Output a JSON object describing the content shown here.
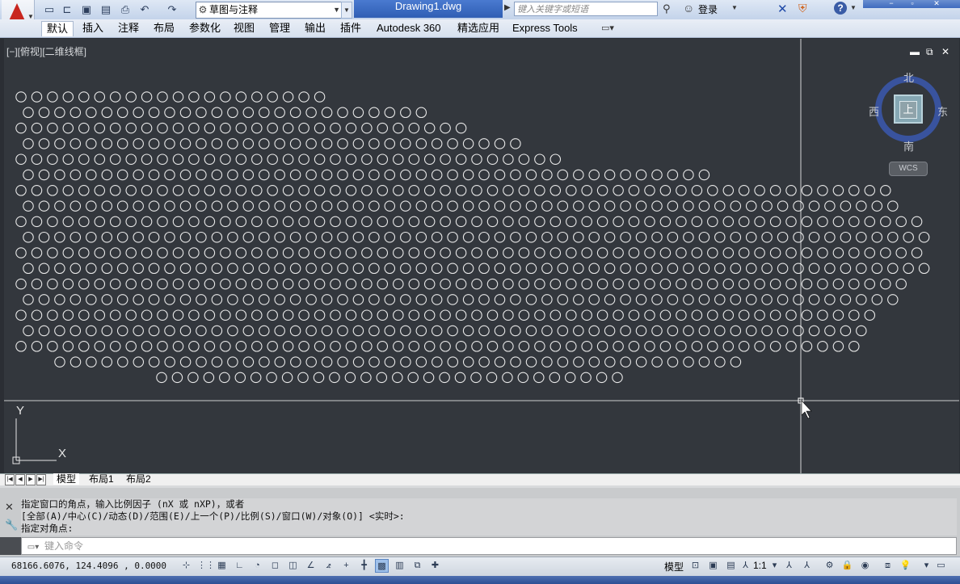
{
  "window": {
    "title": "Drawing1.dwg",
    "workspace": "草图与注释",
    "search_placeholder": "键入关键字或短语",
    "login": "登录"
  },
  "ribbon_tabs": [
    {
      "label": "默认",
      "active": true
    },
    {
      "label": "插入"
    },
    {
      "label": "注释"
    },
    {
      "label": "布局"
    },
    {
      "label": "参数化"
    },
    {
      "label": "视图"
    },
    {
      "label": "管理"
    },
    {
      "label": "输出"
    },
    {
      "label": "插件"
    },
    {
      "label": "Autodesk 360"
    },
    {
      "label": "精选应用"
    },
    {
      "label": "Express Tools"
    }
  ],
  "viewport": {
    "label": "[−][俯视][二维线框]",
    "viewcube": {
      "north": "北",
      "south": "南",
      "east": "东",
      "west": "西",
      "top": "上",
      "ucs": "WCS"
    },
    "ucs_icon": {
      "x": "X",
      "y": "Y"
    },
    "drawing_colors": {
      "background": "#33373d",
      "entities": "#e8e8e8",
      "crosshair": "#ffffff"
    }
  },
  "layout_tabs": [
    "模型",
    "布局1",
    "布局2"
  ],
  "command": {
    "history": [
      "指定窗口的角点，输入比例因子 (nX 或 nXP)，或者",
      "[全部(A)/中心(C)/动态(D)/范围(E)/上一个(P)/比例(S)/窗口(W)/对象(O)] <实时>:",
      "指定对角点:"
    ],
    "input_placeholder": "键入命令"
  },
  "status": {
    "coordinates": "68166.6076, 124.4096 , 0.0000",
    "model": "模型",
    "annotation_scale": "1:1"
  }
}
